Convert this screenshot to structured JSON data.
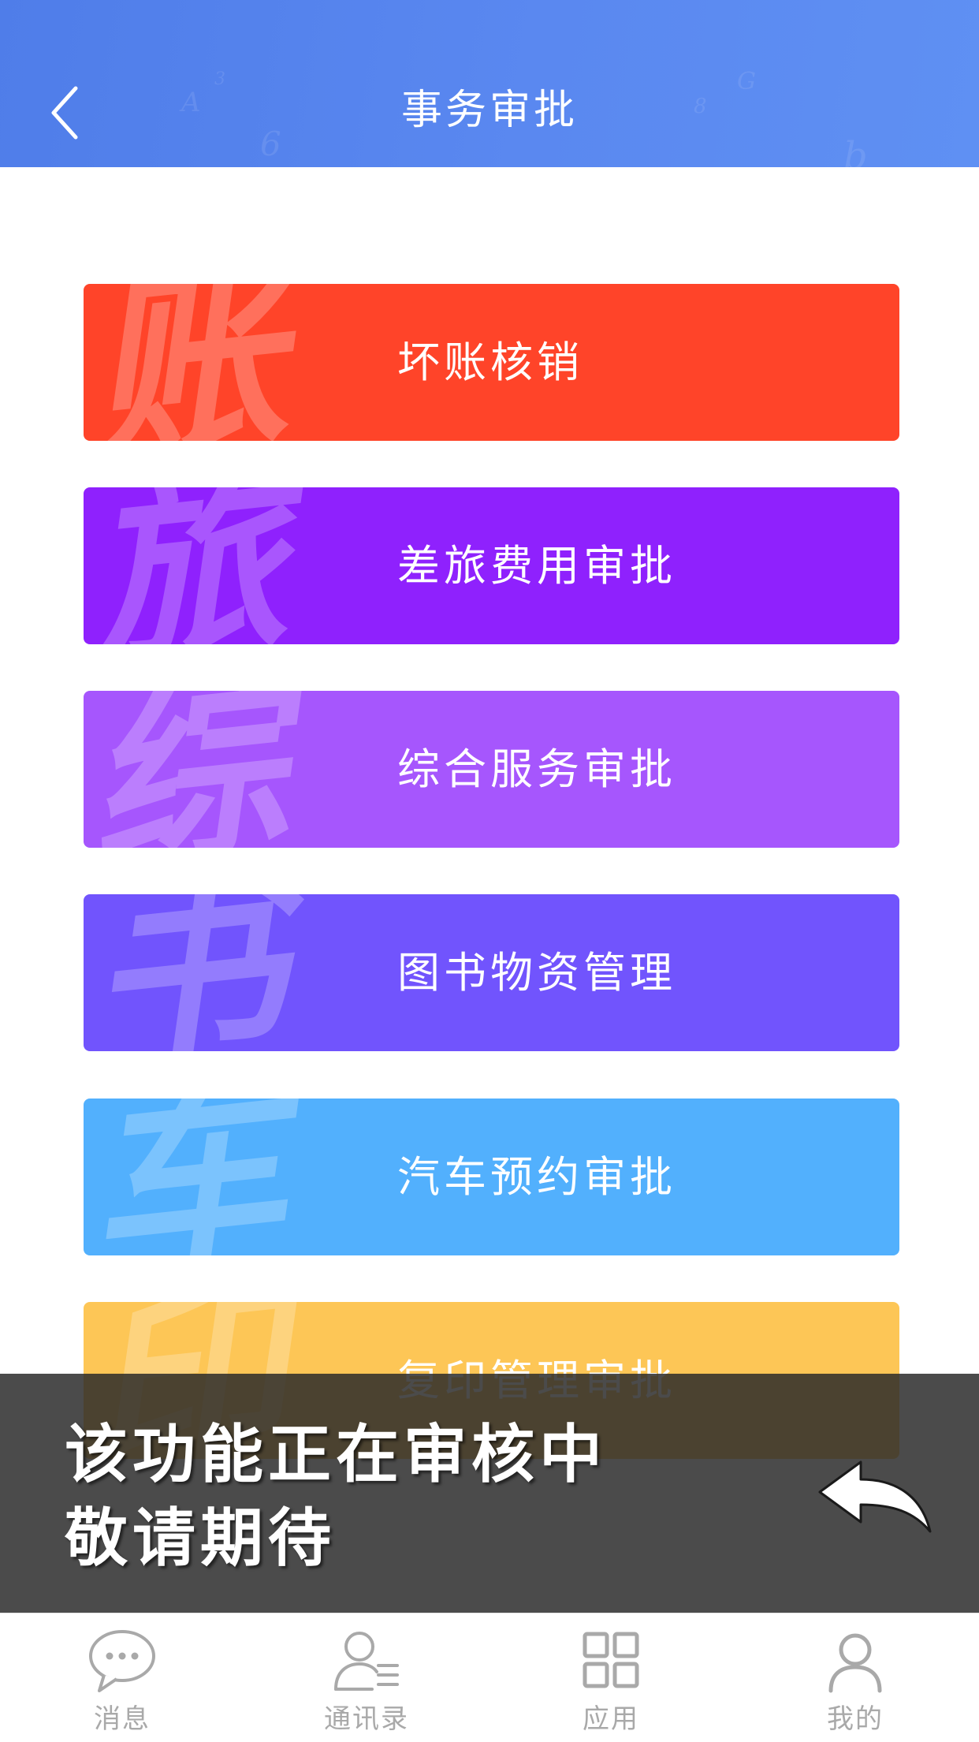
{
  "header": {
    "title": "事务审批"
  },
  "cards": [
    {
      "label": "坏账核销",
      "watermark": "账",
      "color": "#ff4429"
    },
    {
      "label": "差旅费用审批",
      "watermark": "旅",
      "color": "#8f21fd"
    },
    {
      "label": "综合服务审批",
      "watermark": "综",
      "color": "#a656fd"
    },
    {
      "label": "图书物资管理",
      "watermark": "书",
      "color": "#7154fd"
    },
    {
      "label": "汽车预约审批",
      "watermark": "车",
      "color": "#52b0fd"
    },
    {
      "label": "复印管理审批",
      "watermark": "印",
      "color": "#fdc656"
    }
  ],
  "toast": {
    "line1": "该功能正在审核中",
    "line2": "敬请期待"
  },
  "tabbar": {
    "items": [
      {
        "label": "消息",
        "icon": "chat-bubble-icon"
      },
      {
        "label": "通讯录",
        "icon": "contacts-icon"
      },
      {
        "label": "应用",
        "icon": "apps-grid-icon"
      },
      {
        "label": "我的",
        "icon": "profile-icon"
      }
    ]
  }
}
